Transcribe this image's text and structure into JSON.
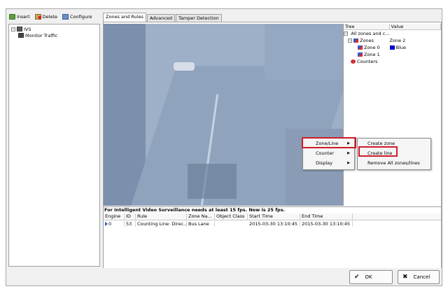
{
  "toolbar": {
    "insert": "Insert",
    "delete": "Delete",
    "configure": "Configure"
  },
  "left_tree": {
    "root": "IVS",
    "child": "Monitor Traffic"
  },
  "tabs": [
    "Zones and Rules",
    "Advanced",
    "Tamper Detection"
  ],
  "tree_grid": {
    "headers": [
      "Tree",
      "Value"
    ],
    "rows": [
      {
        "label": "All zones and c...",
        "value": ""
      },
      {
        "label": "Zones",
        "value": "Zone 2"
      },
      {
        "label": "Zone 0",
        "value": "Blue"
      },
      {
        "label": "Zone 1",
        "value": ""
      },
      {
        "label": "Counters",
        "value": ""
      }
    ],
    "zone0_color": "#0000c8"
  },
  "context_menu": {
    "items": [
      "Zone/Line",
      "Counter",
      "Display"
    ],
    "submenu": [
      "Create zone",
      "Create line",
      "Remove All zones/lines"
    ]
  },
  "notice": "For Intelligent Video Surveillance needs at least 15 fps. Now is 25 fps.",
  "events": {
    "headers": [
      "Engine",
      "ID",
      "Rule",
      "Zone Na...",
      "Object Class",
      "Start Time",
      "End Time"
    ],
    "rows": [
      [
        "0",
        "53",
        "Counting Line: Direc...",
        "Bus Lane",
        "",
        "2015-03-30 13:10:45",
        "2015-03-30 13:10:45"
      ]
    ]
  },
  "buttons": {
    "ok": "OK",
    "cancel": "Cancel"
  },
  "colors": {
    "highlight": "#d01a2a",
    "video_tint": "#9db0c8"
  }
}
